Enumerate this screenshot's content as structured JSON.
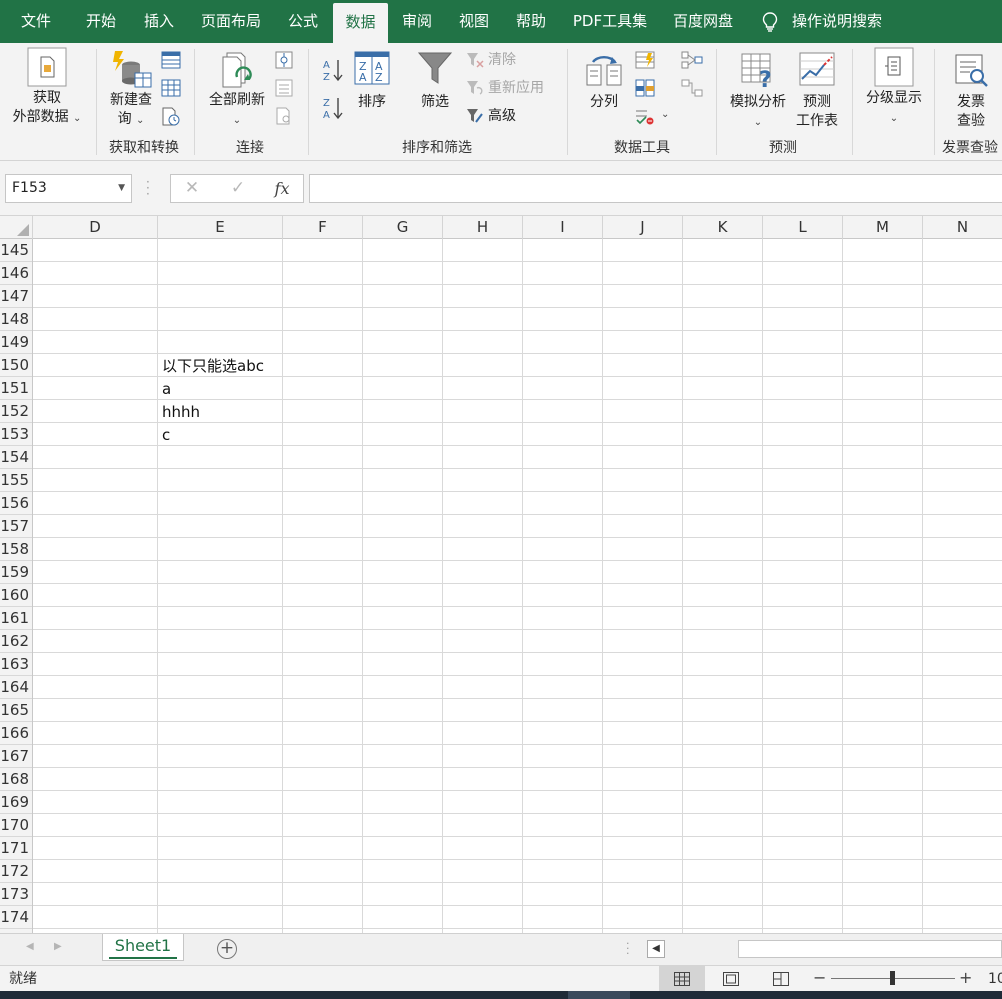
{
  "menu": {
    "tabs": [
      "文件",
      "开始",
      "插入",
      "页面布局",
      "公式",
      "数据",
      "审阅",
      "视图",
      "帮助",
      "PDF工具集",
      "百度网盘"
    ],
    "active_tab": "数据",
    "tellme": "操作说明搜索"
  },
  "ribbon": {
    "get_external": {
      "line1": "获取",
      "line2": "外部数据"
    },
    "new_query": {
      "line1": "新建查",
      "line2": "询"
    },
    "refresh_all": "全部刷新",
    "sort": "排序",
    "filter": "筛选",
    "clear": "清除",
    "reapply": "重新应用",
    "advanced": "高级",
    "text_to_columns": "分列",
    "what_if": "模拟分析",
    "forecast": {
      "line1": "预测",
      "line2": "工作表"
    },
    "outline": "分级显示",
    "invoice": {
      "line1": "发票",
      "line2": "查验"
    },
    "groups": {
      "get_transform": "获取和转换",
      "connections": "连接",
      "sort_filter": "排序和筛选",
      "data_tools": "数据工具",
      "forecast": "预测",
      "invoice": "发票查验"
    }
  },
  "formula_bar": {
    "name_box": "F153",
    "formula": ""
  },
  "columns": [
    "D",
    "E",
    "F",
    "G",
    "H",
    "I",
    "J",
    "K",
    "L",
    "M",
    "N"
  ],
  "rows": [
    "145",
    "146",
    "147",
    "148",
    "149",
    "150",
    "151",
    "152",
    "153",
    "154",
    "155",
    "156",
    "157",
    "158",
    "159",
    "160",
    "161",
    "162",
    "163",
    "164",
    "165",
    "166",
    "167",
    "168",
    "169",
    "170",
    "171",
    "172",
    "173",
    "174"
  ],
  "cells": {
    "E150": "以下只能选abc",
    "E151": "a",
    "E152": "hhhh",
    "E153": "c"
  },
  "sheet": {
    "active": "Sheet1"
  },
  "status": {
    "text": "就绪",
    "zoom": "10"
  }
}
